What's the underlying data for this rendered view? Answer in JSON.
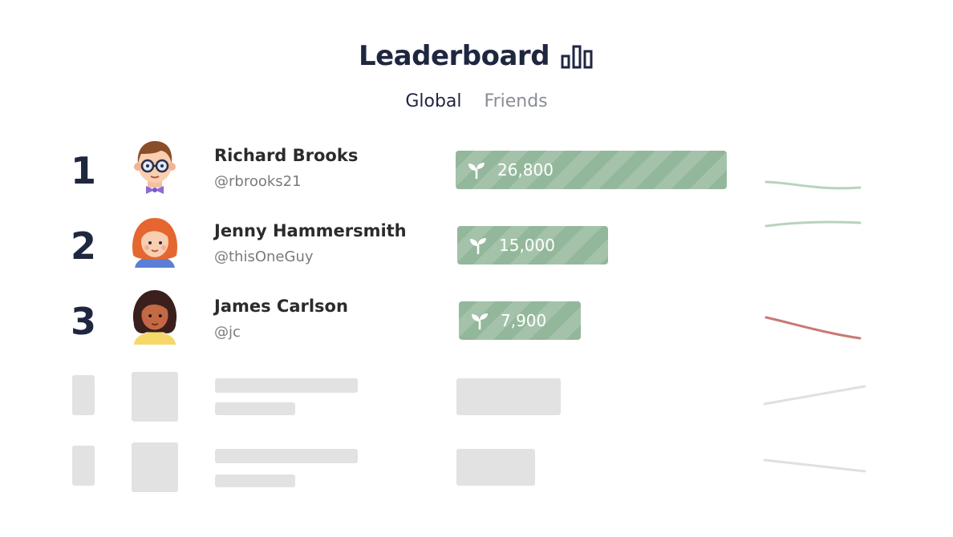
{
  "header": {
    "title": "Leaderboard",
    "icon": "bar-chart-icon"
  },
  "tabs": [
    {
      "label": "Global",
      "active": true
    },
    {
      "label": "Friends",
      "active": false
    }
  ],
  "colors": {
    "heading": "#1f2640",
    "score_bar": "#93b79a",
    "trend_up": "#b7d3bd",
    "trend_down": "#c97974",
    "skeleton": "#e2e2e2"
  },
  "leaders": [
    {
      "rank": "1",
      "name": "Richard Brooks",
      "handle": "@rbrooks21",
      "score": "26,800",
      "score_value": 26800,
      "trend": "flat-up",
      "avatar": "boy-with-glasses-avatar"
    },
    {
      "rank": "2",
      "name": "Jenny Hammersmith",
      "handle": "@thisOneGuy",
      "score": "15,000",
      "score_value": 15000,
      "trend": "flat-up",
      "avatar": "red-haired-girl-avatar"
    },
    {
      "rank": "3",
      "name": "James Carlson",
      "handle": "@jc",
      "score": "7,900",
      "score_value": 7900,
      "trend": "down",
      "avatar": "dark-haired-girl-avatar"
    }
  ]
}
